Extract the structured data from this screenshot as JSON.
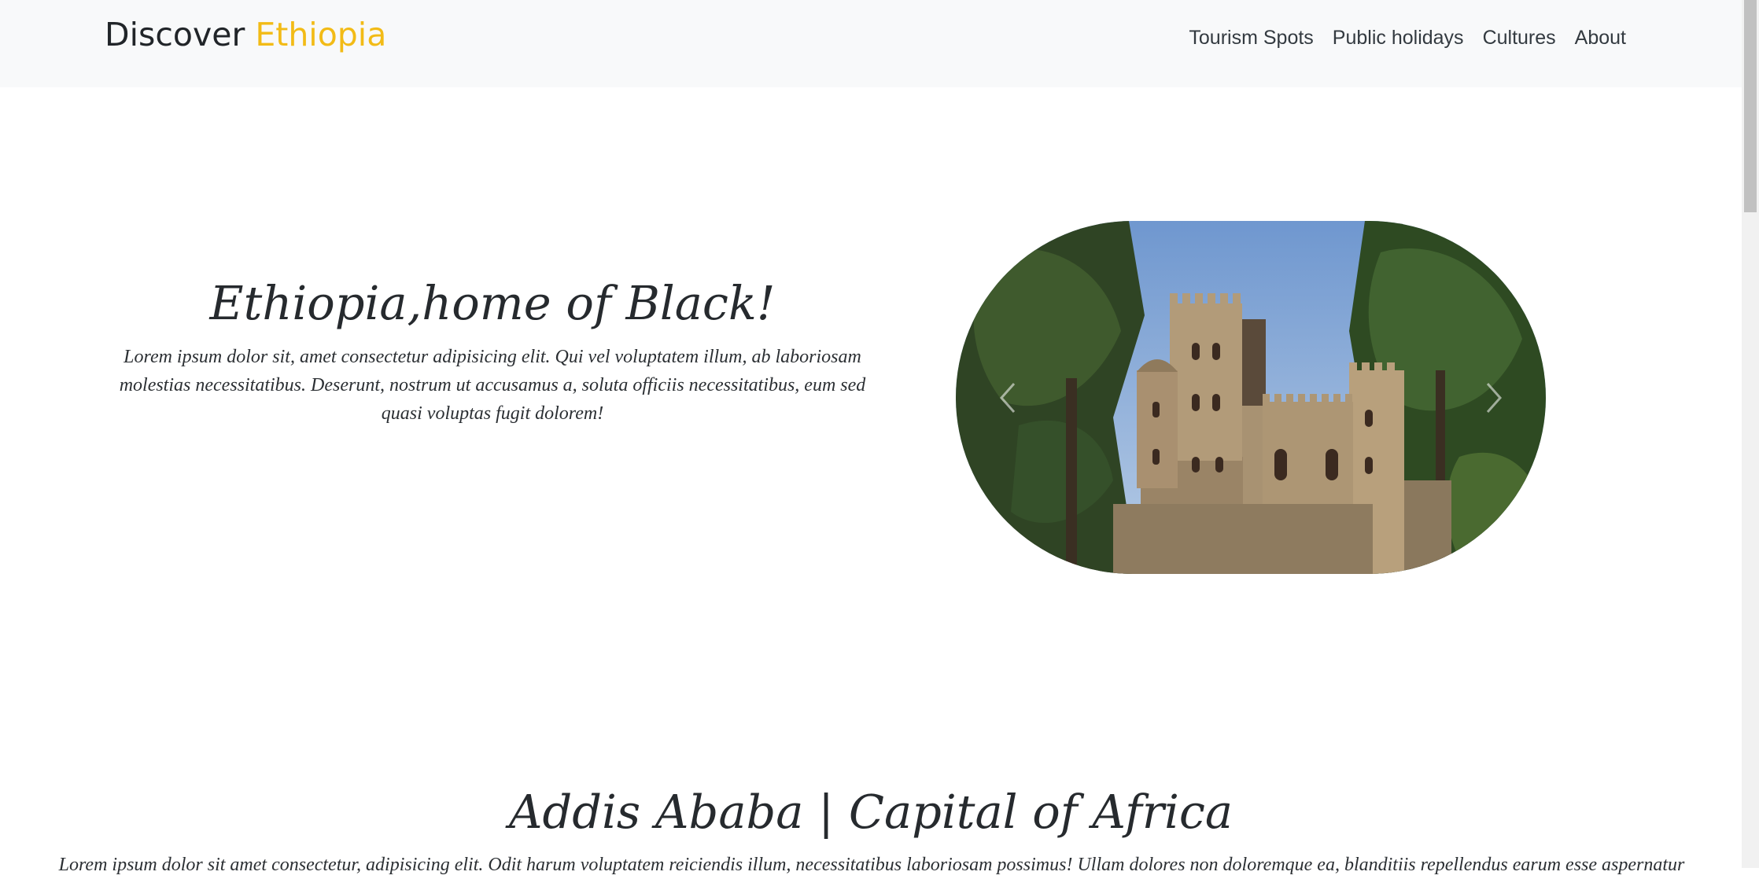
{
  "navbar": {
    "brand_primary": "Discover",
    "brand_accent": "Ethiopia",
    "links": [
      "Tourism Spots",
      "Public holidays",
      "Cultures",
      "About"
    ]
  },
  "hero": {
    "title": "Ethiopia,home of Black!",
    "text": "Lorem ipsum dolor sit, amet consectetur adipisicing elit. Qui vel voluptatem illum, ab laboriosam molestias necessitatibus. Deserunt, nostrum ut accusamus a, soluta officiis necessitatibus, eum sed quasi voluptas fugit dolorem!",
    "carousel": {
      "image": "castle-photo",
      "prev_icon": "chevron-left-icon",
      "next_icon": "chevron-right-icon"
    }
  },
  "section": {
    "title": "Addis Ababa | Capital of Africa",
    "text": "Lorem ipsum dolor sit amet consectetur, adipisicing elit. Odit harum voluptatem reiciendis illum, necessitatibus laboriosam possimus! Ullam dolores non doloremque ea, blanditiis repellendus earum esse aspernatur"
  },
  "colors": {
    "accent": "#f2bb16",
    "navbar_bg": "#f8f9fa",
    "text": "#212529"
  }
}
